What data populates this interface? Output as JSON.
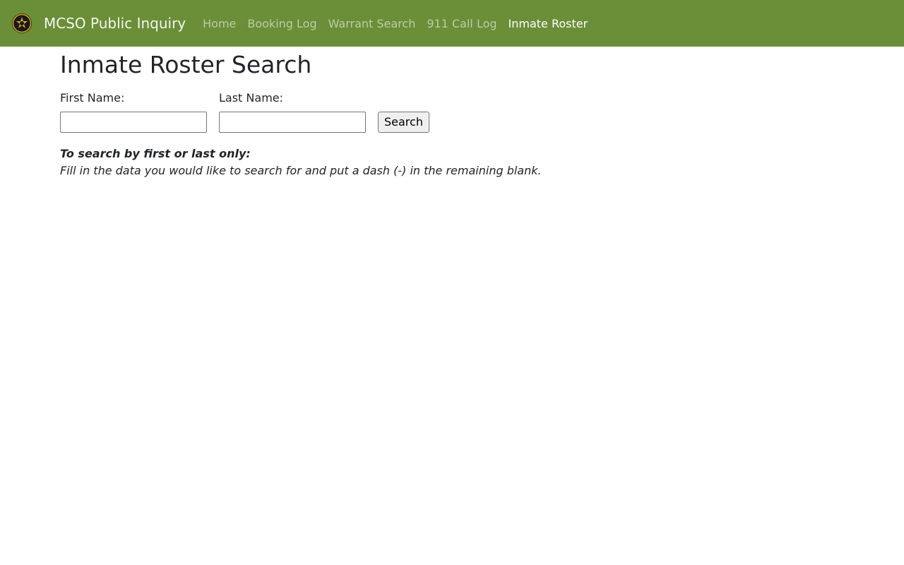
{
  "navbar": {
    "brand_name": "MCSO Public Inquiry",
    "background_color": "#6b8e38",
    "links": [
      {
        "label": "Home",
        "active": false
      },
      {
        "label": "Booking Log",
        "active": false
      },
      {
        "label": "Warrant Search",
        "active": false
      },
      {
        "label": "911 Call Log",
        "active": false
      },
      {
        "label": "Inmate Roster",
        "active": true
      }
    ]
  },
  "main": {
    "title": "Inmate Roster Search",
    "form": {
      "first_name_label": "First Name:",
      "first_name_value": "",
      "last_name_label": "Last Name:",
      "last_name_value": "",
      "search_button_label": "Search"
    },
    "hint": {
      "title": "To search by first or last only:",
      "body": "Fill in the data you would like to search for and put a dash (-) in the remaining blank."
    }
  }
}
